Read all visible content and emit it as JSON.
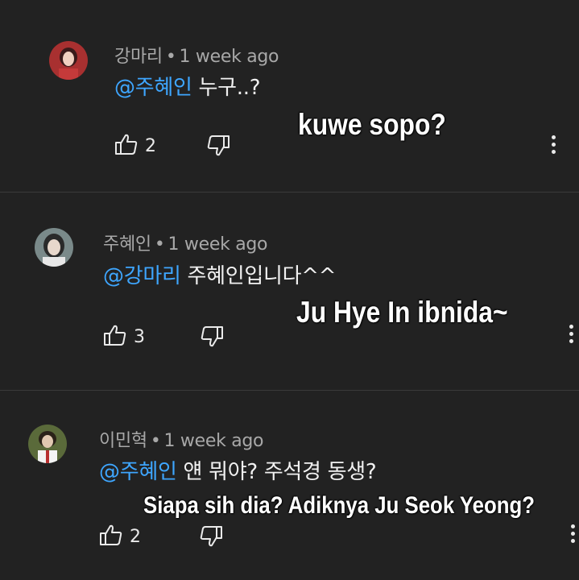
{
  "comments": [
    {
      "author": "강마리",
      "separator": "•",
      "time": "1 week ago",
      "mention": "@주혜인",
      "text": " 누구..?",
      "likes": "2",
      "translation": "kuwe sopo?",
      "avatar_colors": [
        "#c43a3a",
        "#f0d0c0",
        "#3a1a1a"
      ]
    },
    {
      "author": "주혜인",
      "separator": "•",
      "time": "1 week ago",
      "mention": "@강마리",
      "text": " 주혜인입니다^^",
      "likes": "3",
      "translation": "Ju Hye In ibnida~",
      "avatar_colors": [
        "#7a8a8a",
        "#e8d8cc",
        "#2a2a2a"
      ]
    },
    {
      "author": "이민혁",
      "separator": "•",
      "time": "1 week ago",
      "mention": "@주혜인",
      "text": " 얜 뭐야? 주석경 동생?",
      "likes": "2",
      "translation": "Siapa sih dia? Adiknya Ju Seok Yeong?",
      "avatar_colors": [
        "#5a6a3a",
        "#e0c8b0",
        "#f4f4f4"
      ]
    }
  ],
  "icons": {
    "like": "thumbs-up-outline-icon",
    "dislike": "thumbs-down-outline-icon",
    "more": "more-vertical-icon"
  },
  "colors": {
    "background": "#222222",
    "mention": "#3ea6ff",
    "meta": "#a8a8a8",
    "text": "#f1f1f1"
  }
}
